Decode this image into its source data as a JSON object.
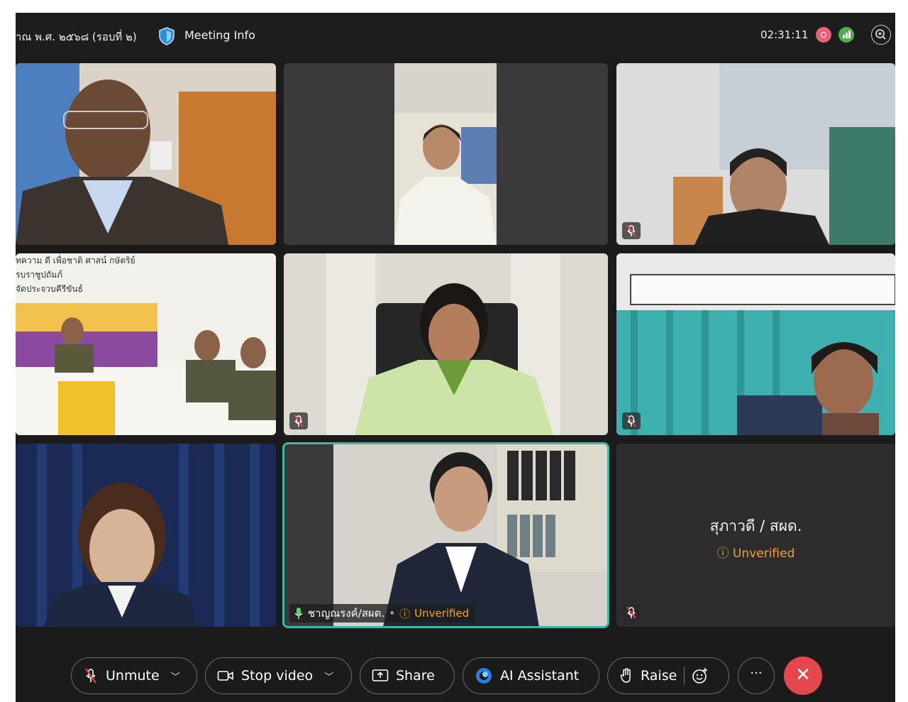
{
  "topbar": {
    "title": "าณ พ.ศ. ๒๕๖๘ (รอบที่ ๒)",
    "meeting_info": "Meeting Info",
    "timer": "02:31:11"
  },
  "tiles": {
    "t3_banner": [
      "ทความ ดี เพื่อชาติ ศาสน์ กษัตริย์",
      "รบราชูปถัมภ์",
      "จัดประจวบคีรีขันธ์"
    ],
    "active_name": "ชาญณรงค์/สผด.",
    "active_status": "Unverified",
    "placeholder_name": "สุภาวดี / สผด.",
    "placeholder_status": "Unverified"
  },
  "toolbar": {
    "unmute": "Unmute",
    "stop_video": "Stop video",
    "share": "Share",
    "ai_assistant": "AI Assistant",
    "raise": "Raise",
    "more": "···"
  },
  "colors": {
    "accent_active": "#3fb5a2",
    "unverified": "#f0a13a",
    "end_call": "#e5474f",
    "recording": "#e8627a",
    "stats": "#4cb050"
  }
}
